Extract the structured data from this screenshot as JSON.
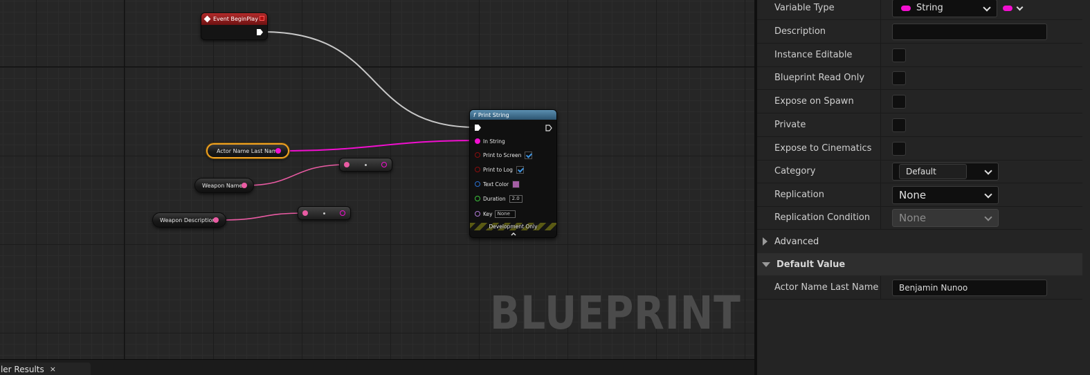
{
  "graph": {
    "watermark": "BLUEPRINT",
    "event_node": {
      "title": "Event BeginPlay"
    },
    "var_nodes": [
      {
        "label": "Actor Name Last Name"
      },
      {
        "label": "Weapon Name"
      },
      {
        "label": "Weapon Description"
      }
    ],
    "print_node": {
      "title": "Print String",
      "function_glyph": "f",
      "in_string": "In String",
      "print_to_screen": "Print to Screen",
      "print_to_screen_checked": true,
      "print_to_log": "Print to Log",
      "print_to_log_checked": true,
      "text_color": "Text Color",
      "text_color_value": "#a45ea4",
      "duration": "Duration",
      "duration_value": "2.0",
      "key": "Key",
      "key_value": "None",
      "dev_only": "Development Only"
    },
    "colors": {
      "exec_wire": "#c8c8c8",
      "string_pin": "#f20fd0",
      "name_pin": "#ea5ba3",
      "event_header": "#b12a2a",
      "function_header": "#5b8fb0",
      "selection": "#f2a321"
    }
  },
  "bottom_tab": {
    "label": "piler Results",
    "close": "×"
  },
  "details": {
    "rows": [
      {
        "name": "Variable Type",
        "value": "String"
      },
      {
        "name": "Description",
        "value": ""
      },
      {
        "name": "Instance Editable"
      },
      {
        "name": "Blueprint Read Only"
      },
      {
        "name": "Expose on Spawn"
      },
      {
        "name": "Private"
      },
      {
        "name": "Expose to Cinematics"
      },
      {
        "name": "Category",
        "value": "Default"
      },
      {
        "name": "Replication",
        "value": "None"
      },
      {
        "name": "Replication Condition",
        "value": "None"
      }
    ],
    "advanced": "Advanced",
    "default_value_header": "Default Value",
    "default_row": {
      "name": "Actor Name Last Name",
      "value": "Benjamin Nunoo"
    }
  }
}
